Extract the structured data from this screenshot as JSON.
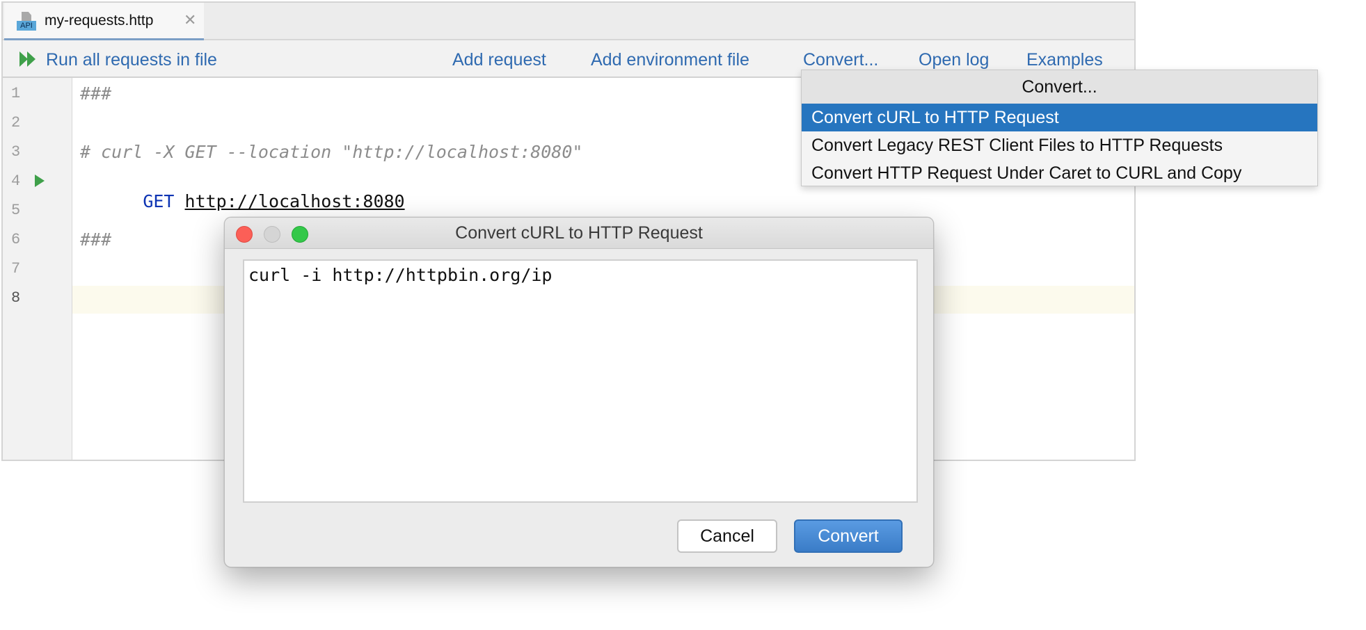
{
  "tab": {
    "icon": "api-file-icon",
    "icon_text": "API",
    "label": "my-requests.http",
    "close_glyph": "✕"
  },
  "toolbar": {
    "run_all": "Run all requests in file",
    "add_request": "Add request",
    "add_env_file": "Add environment file",
    "convert": "Convert...",
    "open_log": "Open log",
    "examples": "Examples"
  },
  "editor": {
    "line_numbers": [
      "1",
      "2",
      "3",
      "4",
      "5",
      "6",
      "7",
      "8"
    ],
    "lines": {
      "l1": "###",
      "l3": "# curl -X GET --location \"http://localhost:8080\"",
      "l4_method": "GET",
      "l4_url": "http://localhost:8080",
      "l6": "###"
    },
    "current_line": "8"
  },
  "menu": {
    "title": "Convert...",
    "items": [
      {
        "label": "Convert cURL to HTTP Request",
        "selected": true
      },
      {
        "label": "Convert Legacy REST Client Files to HTTP Requests",
        "selected": false
      },
      {
        "label": "Convert HTTP Request Under Caret to CURL and Copy",
        "selected": false
      }
    ]
  },
  "dialog": {
    "title": "Convert cURL to HTTP Request",
    "input_value": "curl -i http://httpbin.org/ip",
    "cancel_label": "Cancel",
    "convert_label": "Convert"
  },
  "colors": {
    "link": "#2f6ab0",
    "selection": "#2675bf",
    "run_green": "#3fa04a",
    "keyword": "#0c33b3",
    "primary_button": "#3a7cc7"
  }
}
